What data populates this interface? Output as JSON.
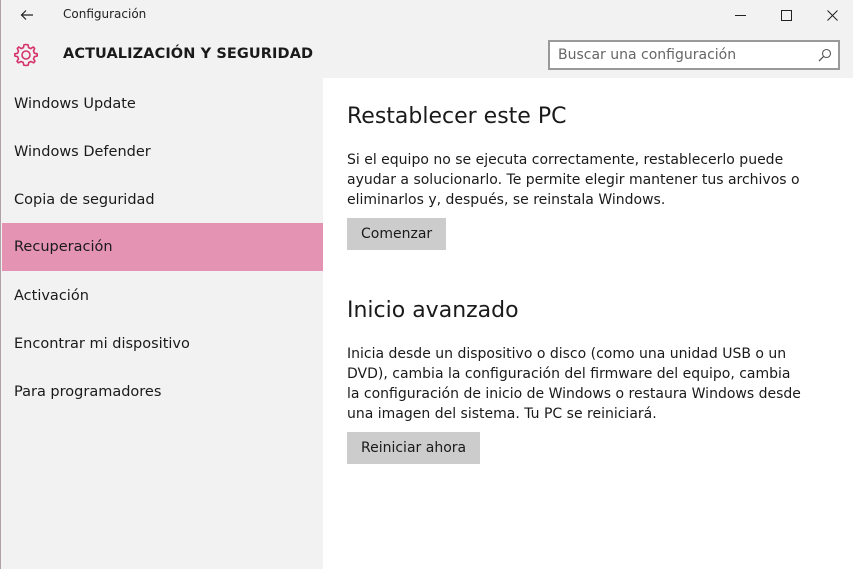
{
  "window": {
    "title": "Configuración"
  },
  "header": {
    "section_title": "ACTUALIZACIÓN Y SEGURIDAD",
    "search_placeholder": "Buscar una configuración"
  },
  "sidebar": {
    "items": [
      {
        "label": "Windows Update"
      },
      {
        "label": "Windows Defender"
      },
      {
        "label": "Copia de seguridad"
      },
      {
        "label": "Recuperación",
        "selected": true
      },
      {
        "label": "Activación"
      },
      {
        "label": "Encontrar mi dispositivo"
      },
      {
        "label": "Para programadores"
      }
    ]
  },
  "main": {
    "reset": {
      "title": "Restablecer este PC",
      "description": "Si el equipo no se ejecuta correctamente, restablecerlo puede ayudar a solucionarlo. Te permite elegir mantener tus archivos o eliminarlos y, después, se reinstala Windows.",
      "button": "Comenzar"
    },
    "advanced": {
      "title": "Inicio avanzado",
      "description": "Inicia desde un dispositivo o disco (como una unidad USB o un DVD), cambia la configuración del firmware del equipo, cambia la configuración de inicio de Windows o restaura Windows desde una imagen del sistema. Tu PC se reiniciará.",
      "button": "Reiniciar ahora"
    }
  },
  "colors": {
    "accent": "#e493b3",
    "chrome": "#f2f2f2",
    "button": "#cccccc"
  }
}
